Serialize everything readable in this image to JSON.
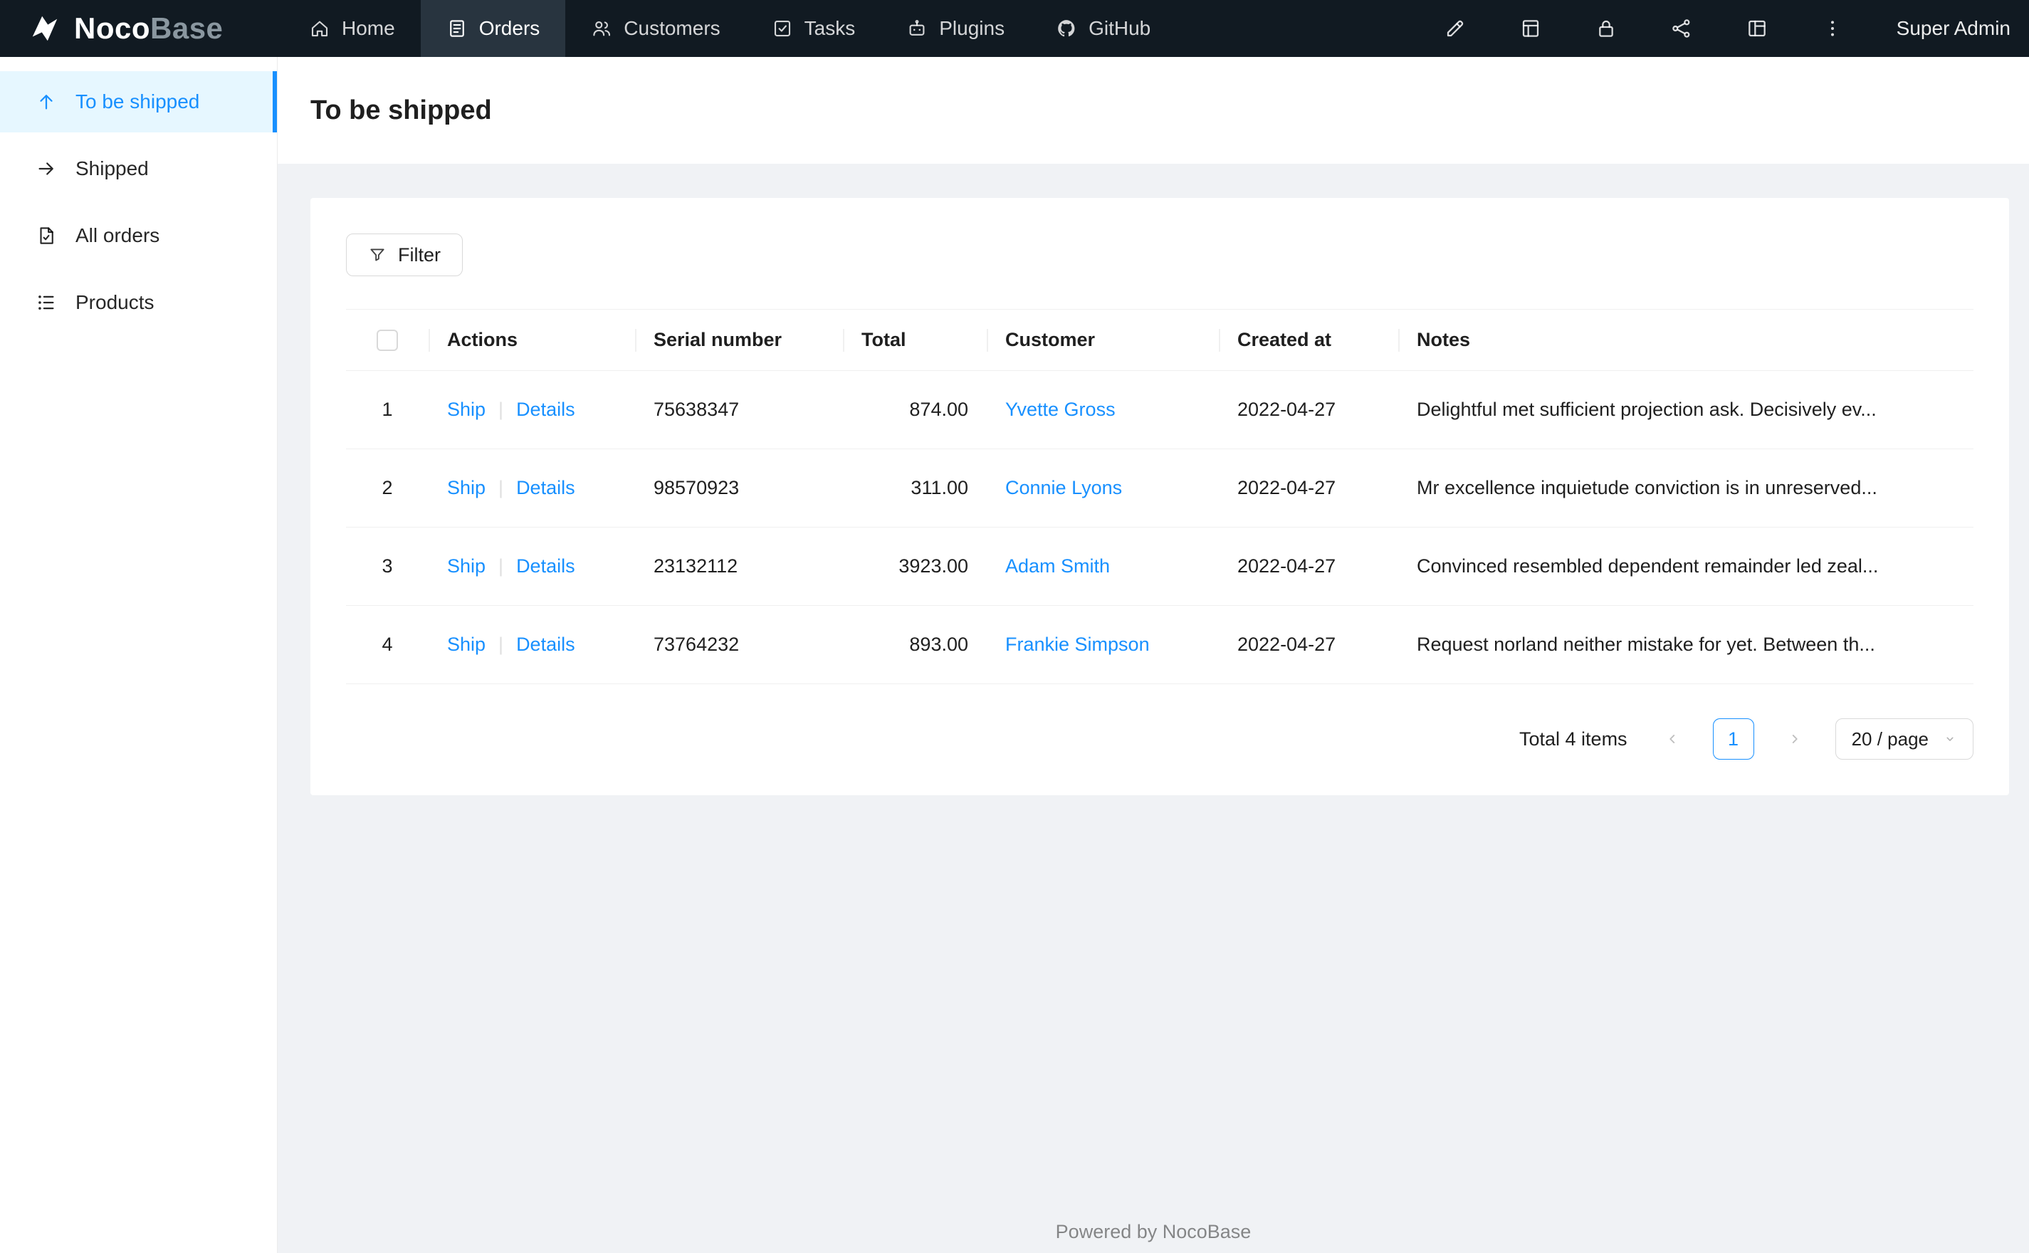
{
  "colors": {
    "accent": "#1890ff",
    "navbar_bg": "#111a22",
    "navbar_active_bg": "#28343f",
    "sidebar_active_bg": "#e6f7ff",
    "page_bg": "#f0f2f5",
    "border": "#f0f0f0"
  },
  "navbar": {
    "logo_noco": "Noco",
    "logo_base": "Base",
    "items": [
      {
        "label": "Home",
        "icon": "home-icon"
      },
      {
        "label": "Orders",
        "icon": "orders-icon"
      },
      {
        "label": "Customers",
        "icon": "customers-icon"
      },
      {
        "label": "Tasks",
        "icon": "tasks-icon"
      },
      {
        "label": "Plugins",
        "icon": "plugins-icon"
      },
      {
        "label": "GitHub",
        "icon": "github-icon"
      }
    ],
    "active_item": "Orders",
    "tools": [
      "ui-editor-pen-icon",
      "collections-icon",
      "lock-icon",
      "api-nodes-icon",
      "layout-icon",
      "more-icon"
    ],
    "user": "Super Admin"
  },
  "sidebar": {
    "items": [
      {
        "label": "To be shipped",
        "icon": "arrow-up-icon",
        "active": true
      },
      {
        "label": "Shipped",
        "icon": "arrow-right-icon",
        "active": false
      },
      {
        "label": "All orders",
        "icon": "file-check-icon",
        "active": false
      },
      {
        "label": "Products",
        "icon": "list-icon",
        "active": false
      }
    ]
  },
  "page": {
    "title": "To be shipped"
  },
  "toolbar": {
    "filter_label": "Filter"
  },
  "table": {
    "headers": [
      "Actions",
      "Serial number",
      "Total",
      "Customer",
      "Created at",
      "Notes"
    ],
    "actions": {
      "ship": "Ship",
      "divider": "|",
      "details": "Details"
    },
    "rows": [
      {
        "index": "1",
        "serial": "75638347",
        "total": "874.00",
        "customer": "Yvette Gross",
        "created_at": "2022-04-27",
        "notes": "Delightful met sufficient projection ask. Decisively ev..."
      },
      {
        "index": "2",
        "serial": "98570923",
        "total": "311.00",
        "customer": "Connie Lyons",
        "created_at": "2022-04-27",
        "notes": "Mr excellence inquietude conviction is in unreserved..."
      },
      {
        "index": "3",
        "serial": "23132112",
        "total": "3923.00",
        "customer": "Adam Smith",
        "created_at": "2022-04-27",
        "notes": "Convinced resembled dependent remainder led zeal..."
      },
      {
        "index": "4",
        "serial": "73764232",
        "total": "893.00",
        "customer": "Frankie Simpson",
        "created_at": "2022-04-27",
        "notes": "Request norland neither mistake for yet. Between th..."
      }
    ]
  },
  "pagination": {
    "total_text": "Total 4 items",
    "current_page": "1",
    "page_size": "20 / page"
  },
  "footer": {
    "text": "Powered by NocoBase"
  }
}
